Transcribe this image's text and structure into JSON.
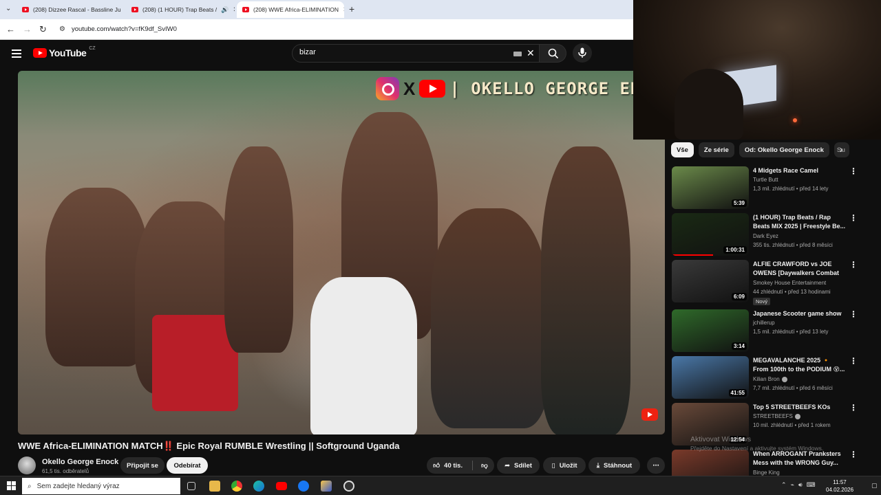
{
  "browser": {
    "tabs": [
      {
        "title": "(208) Dizzee Rascal - Bassline Ju",
        "active": false
      },
      {
        "title": "(208) (1 HOUR) Trap Beats /",
        "active": false
      },
      {
        "title": "(208) WWE Africa-ELIMINATION",
        "active": true
      }
    ],
    "url": "youtube.com/watch?v=fK9df_SvIW0"
  },
  "youtube": {
    "logo_text": "YouTube",
    "region": "CZ",
    "search_value": "bizar"
  },
  "video": {
    "overlay_text": "| OKELLO GEORGE ENO",
    "title": "WWE Africa-ELIMINATION MATCH‼️ Epic Royal RUMBLE Wrestling || Softground Uganda",
    "channel": "Okello George Enock",
    "subscribers": "61,5 tis. odběratelů",
    "join_label": "Připojit se",
    "subscribe_label": "Odebírat",
    "likes": "40 tis.",
    "share_label": "Sdílet",
    "save_label": "Uložit",
    "download_label": "Stáhnout"
  },
  "sidebar": {
    "chips": [
      "Vše",
      "Ze série",
      "Od: Okello George Enock",
      "Su"
    ],
    "items": [
      {
        "title": "4 Midgets Race Camel",
        "channel": "Turtle Butt",
        "meta": "1,3 mil. zhlédnutí • před 14 lety",
        "duration": "5:39",
        "badge": "",
        "verified": false,
        "thumb": "#6b8a4a"
      },
      {
        "title": "(1 HOUR) Trap Beats / Rap Beats MIX 2025 | Freestyle Be...",
        "channel": "Dark Eyez",
        "meta": "355 tis. zhlédnutí • před 8 měsíci",
        "duration": "1:00:31",
        "badge": "",
        "verified": false,
        "thumb": "#1a2a14"
      },
      {
        "title": "ALFIE CRAWFORD vs JOE OWENS [Daywalkers Combat ...",
        "channel": "Smokey House Entertainment",
        "meta": "44 zhlédnutí • před 13 hodinami",
        "duration": "6:09",
        "badge": "Nový",
        "verified": false,
        "thumb": "#3a3a3a"
      },
      {
        "title": "Japanese Scooter game show",
        "channel": "jchillerup",
        "meta": "1,5 mil. zhlédnutí • před 13 lety",
        "duration": "3:14",
        "badge": "",
        "verified": false,
        "thumb": "#2f6a2a"
      },
      {
        "title": "MEGAVALANCHE 2025 🔸 From 100th to the PODIUM 😵...",
        "channel": "Kilian Bron",
        "meta": "7,7 mil. zhlédnutí • před 6 měsíci",
        "duration": "41:55",
        "badge": "",
        "verified": true,
        "thumb": "#4a78a8"
      },
      {
        "title": "Top 5 STREETBEEFS KOs",
        "channel": "STREETBEEFS",
        "meta": "10 mil. zhlédnutí • před 1 rokem",
        "duration": "12:54",
        "badge": "",
        "verified": true,
        "thumb": "#6a4a3a"
      },
      {
        "title": "When ARROGANT Pranksters Mess with the WRONG Guy...",
        "channel": "Binge King",
        "meta": "",
        "duration": "",
        "badge": "",
        "verified": false,
        "thumb": "#7a3a2a"
      }
    ]
  },
  "windows": {
    "activate_title": "Aktivovat Windows",
    "activate_text": "Přejděte do Nastavení a aktivujte systém Windows.",
    "search_placeholder": "Sem zadejte hledaný výraz",
    "time": "11:57",
    "date": "04.02.2026"
  }
}
